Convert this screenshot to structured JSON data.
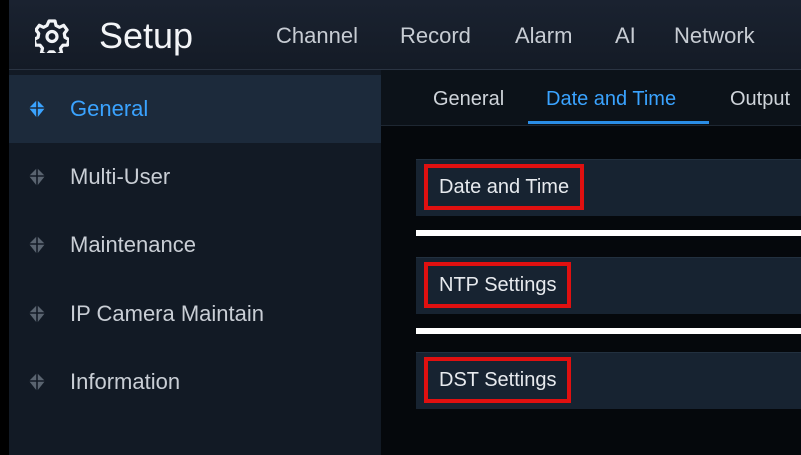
{
  "header": {
    "title": "Setup",
    "logo_icon": "gear-icon",
    "nav": [
      "Channel",
      "Record",
      "Alarm",
      "AI",
      "Network"
    ]
  },
  "sidebar": {
    "items": [
      {
        "label": "General",
        "icon": "diamond-icon",
        "active": true
      },
      {
        "label": "Multi-User",
        "icon": "diamond-icon",
        "active": false
      },
      {
        "label": "Maintenance",
        "icon": "diamond-icon",
        "active": false
      },
      {
        "label": "IP Camera Maintain",
        "icon": "diamond-icon",
        "active": false
      },
      {
        "label": "Information",
        "icon": "diamond-icon",
        "active": false
      }
    ]
  },
  "tabs": [
    {
      "label": "General",
      "active": false
    },
    {
      "label": "Date and Time",
      "active": true
    },
    {
      "label": "Output",
      "active": false
    }
  ],
  "sections": [
    {
      "label": "Date and Time"
    },
    {
      "label": "NTP Settings"
    },
    {
      "label": "DST Settings"
    }
  ],
  "colors": {
    "accent": "#3aa3ff",
    "highlight_box": "#e01010",
    "active_sidebar_bg": "#1c2a3b"
  }
}
